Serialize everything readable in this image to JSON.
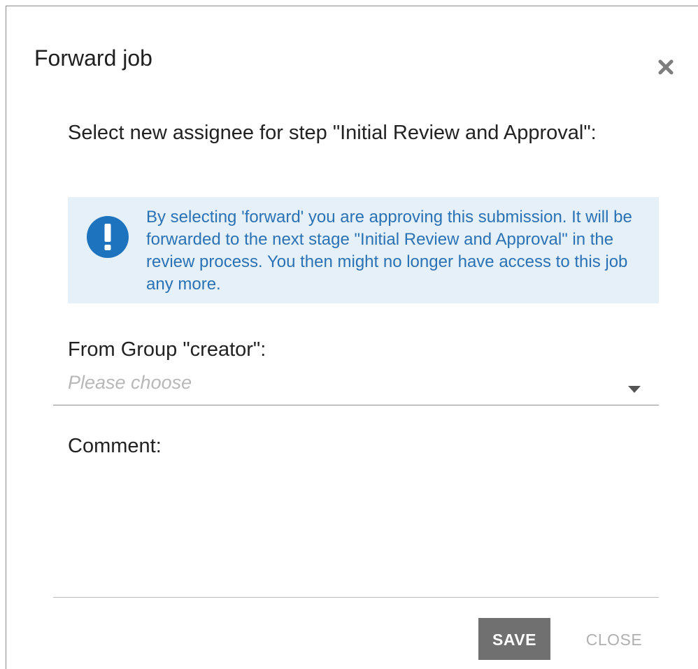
{
  "dialog": {
    "title": "Forward job",
    "close_icon": "close-icon",
    "step_heading": "Select new assignee for step \"Initial Review and Approval\":",
    "info": {
      "icon": "exclamation-circle-icon",
      "text": "By selecting 'forward' you are approving this submission. It will be forwarded to the next stage \"Initial Review and Approval\" in the review process. You then might no longer have access to this job any more.",
      "accent_color": "#1e73be",
      "background_color": "#e5f0f8"
    },
    "group": {
      "label": "From Group \"creator\":",
      "placeholder": "Please choose",
      "caret_icon": "caret-down-icon"
    },
    "comment": {
      "label": "Comment:",
      "value": ""
    },
    "buttons": {
      "save": "SAVE",
      "close": "CLOSE"
    }
  }
}
